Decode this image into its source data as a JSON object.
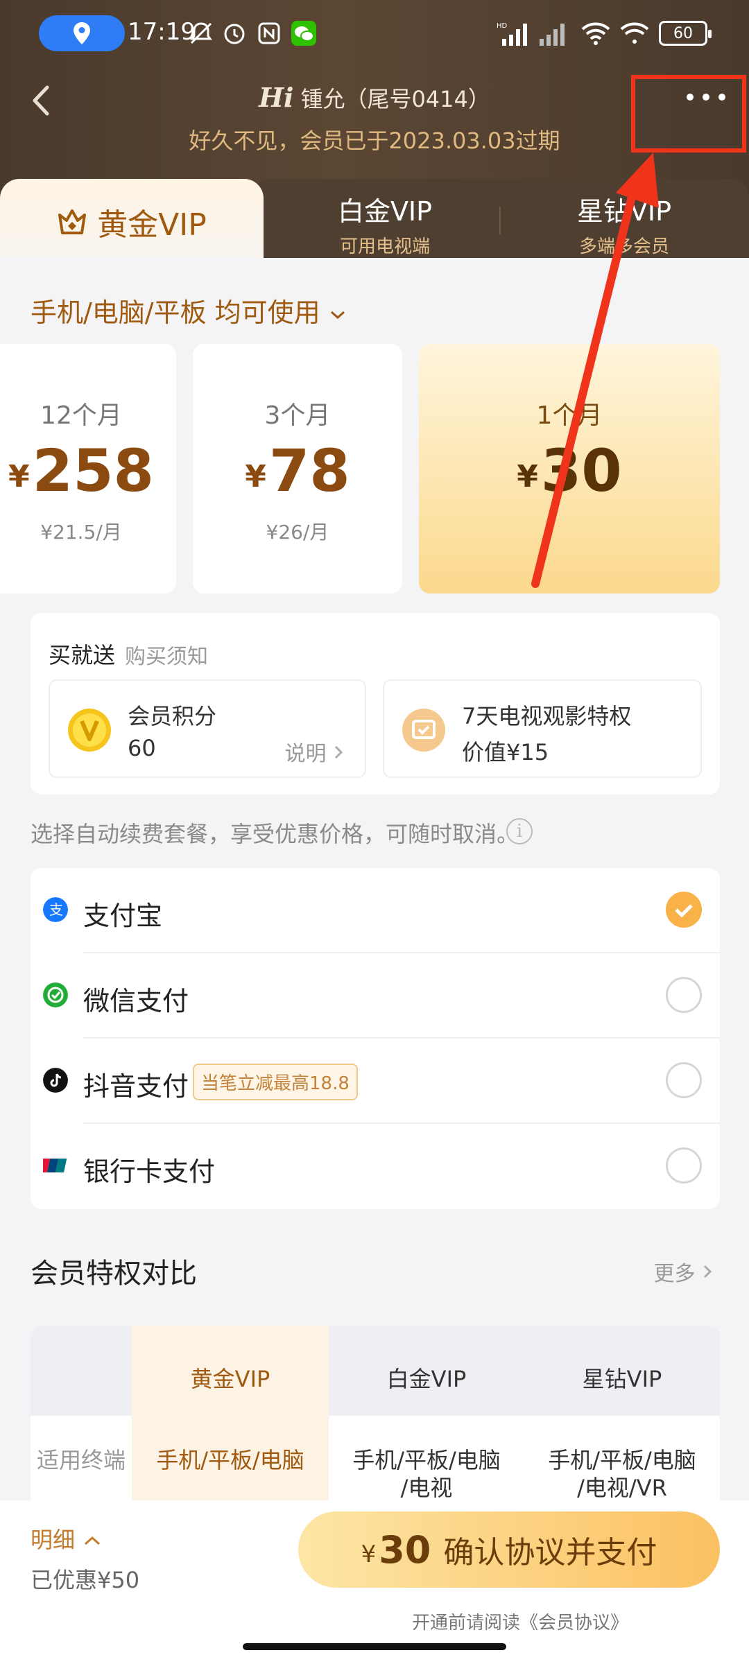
{
  "status_bar": {
    "time": "17:19",
    "battery": "60"
  },
  "header": {
    "greeting_prefix": "Hi",
    "user": "锺允（尾号0414）",
    "subtitle": "好久不见，会员已于2023.03.03过期"
  },
  "tabs": [
    {
      "label": "黄金VIP"
    },
    {
      "label": "白金VIP",
      "sub": "可用电视端"
    },
    {
      "label": "星钻VIP",
      "sub": "多端多会员"
    }
  ],
  "device_select": "手机/电脑/平板 均可使用",
  "plans": [
    {
      "duration": "12个月",
      "yen": "¥",
      "price": "258",
      "per": "¥21.5/月"
    },
    {
      "duration": "3个月",
      "yen": "¥",
      "price": "78",
      "per": "¥26/月"
    },
    {
      "duration": "1个月",
      "yen": "¥",
      "price": "30",
      "per": ""
    }
  ],
  "bonus": {
    "title": "买就送",
    "notice": "购买须知",
    "items": [
      {
        "title": "会员积分",
        "value": "60",
        "explain": "说明"
      },
      {
        "title": "7天电视观影特权",
        "value": "价值¥15"
      }
    ]
  },
  "auto_renew_note": "选择自动续费套餐，享受优惠价格，可随时取消。",
  "payments": [
    {
      "name": "支付宝",
      "checked": true
    },
    {
      "name": "微信支付",
      "checked": false
    },
    {
      "name": "抖音支付",
      "promo": "当笔立减最高18.8",
      "checked": false
    },
    {
      "name": "银行卡支付",
      "checked": false
    }
  ],
  "compare": {
    "title": "会员特权对比",
    "more": "更多",
    "headers": [
      "黄金VIP",
      "白金VIP",
      "星钻VIP"
    ],
    "row_label": "适用终端",
    "row_values": [
      "手机/平板/电脑",
      "手机/平板/电脑\n/电视",
      "手机/平板/电脑\n/电视/VR"
    ]
  },
  "bottom": {
    "detail": "明细",
    "saved": "已优惠¥50",
    "pay_yen": "¥",
    "pay_amount": "30",
    "pay_label": "确认协议并支付",
    "agreement": "开通前请阅读《会员协议》"
  },
  "colors": {
    "accent": "#a05a10",
    "annotation": "#f0341c",
    "pay_button": "#fbc162"
  }
}
